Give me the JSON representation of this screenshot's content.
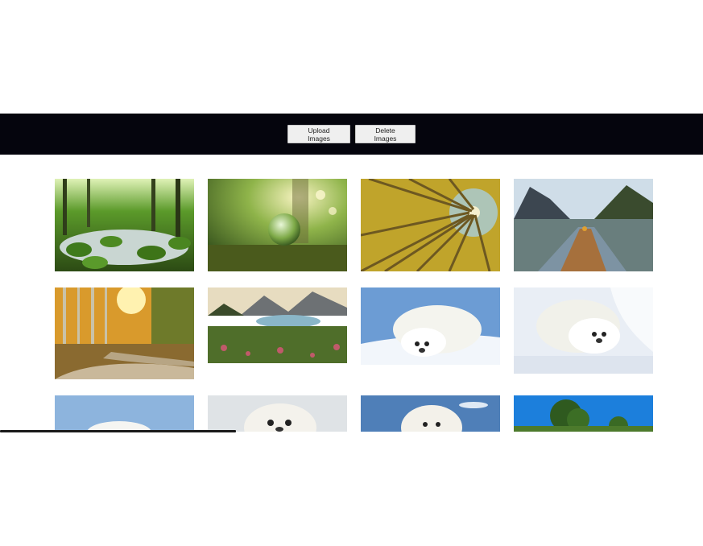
{
  "toolbar": {
    "upload_label": "Upload Images",
    "delete_label": "Delete Images",
    "background": "#05050d"
  },
  "gallery": {
    "images": [
      {
        "name": "forest-stream-mossy-rocks"
      },
      {
        "name": "glass-orb-forest-floor"
      },
      {
        "name": "looking-up-autumn-trees"
      },
      {
        "name": "mountain-lake-wooden-pier"
      },
      {
        "name": "autumn-forest-path"
      },
      {
        "name": "alpine-lake-meadow-sunset"
      },
      {
        "name": "baby-seal-snow"
      },
      {
        "name": "baby-seal-sleeping-snow"
      },
      {
        "name": "baby-seal-blue-sky"
      },
      {
        "name": "baby-seal-snow-closeup"
      },
      {
        "name": "baby-seal-sky-clouds"
      },
      {
        "name": "green-tree-blue-sky"
      }
    ]
  }
}
